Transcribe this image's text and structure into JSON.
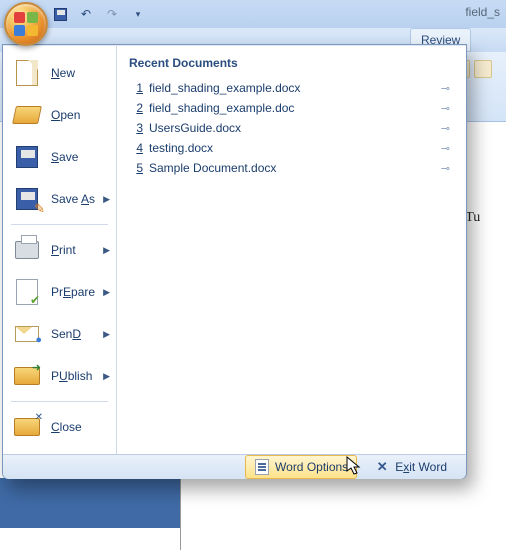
{
  "titlebar": {
    "doc_title": "field_s"
  },
  "ribbon": {
    "visible_tab": "Review"
  },
  "office_menu": {
    "items": [
      {
        "label": "New",
        "accel": "N",
        "submenu": false
      },
      {
        "label": "Open",
        "accel": "O",
        "submenu": false
      },
      {
        "label": "Save",
        "accel": "S",
        "submenu": false
      },
      {
        "label": "Save As",
        "accel": "A",
        "submenu": true
      },
      {
        "label": "Print",
        "accel": "P",
        "submenu": true
      },
      {
        "label": "Prepare",
        "accel": "E",
        "submenu": true
      },
      {
        "label": "Send",
        "accel": "D",
        "submenu": true
      },
      {
        "label": "Publish",
        "accel": "U",
        "submenu": true
      },
      {
        "label": "Close",
        "accel": "C",
        "submenu": false
      }
    ],
    "recent_header": "Recent Documents",
    "recent": [
      {
        "n": "1",
        "name": "field_shading_example.docx"
      },
      {
        "n": "2",
        "name": "field_shading_example.doc"
      },
      {
        "n": "3",
        "name": "UsersGuide.docx"
      },
      {
        "n": "4",
        "name": "testing.docx"
      },
      {
        "n": "5",
        "name": "Sample Document.docx"
      }
    ],
    "footer": {
      "word_options": "Word Options",
      "exit_word": "Exit Word"
    }
  },
  "document_visible_text": {
    "line": "eld:    Tu"
  }
}
